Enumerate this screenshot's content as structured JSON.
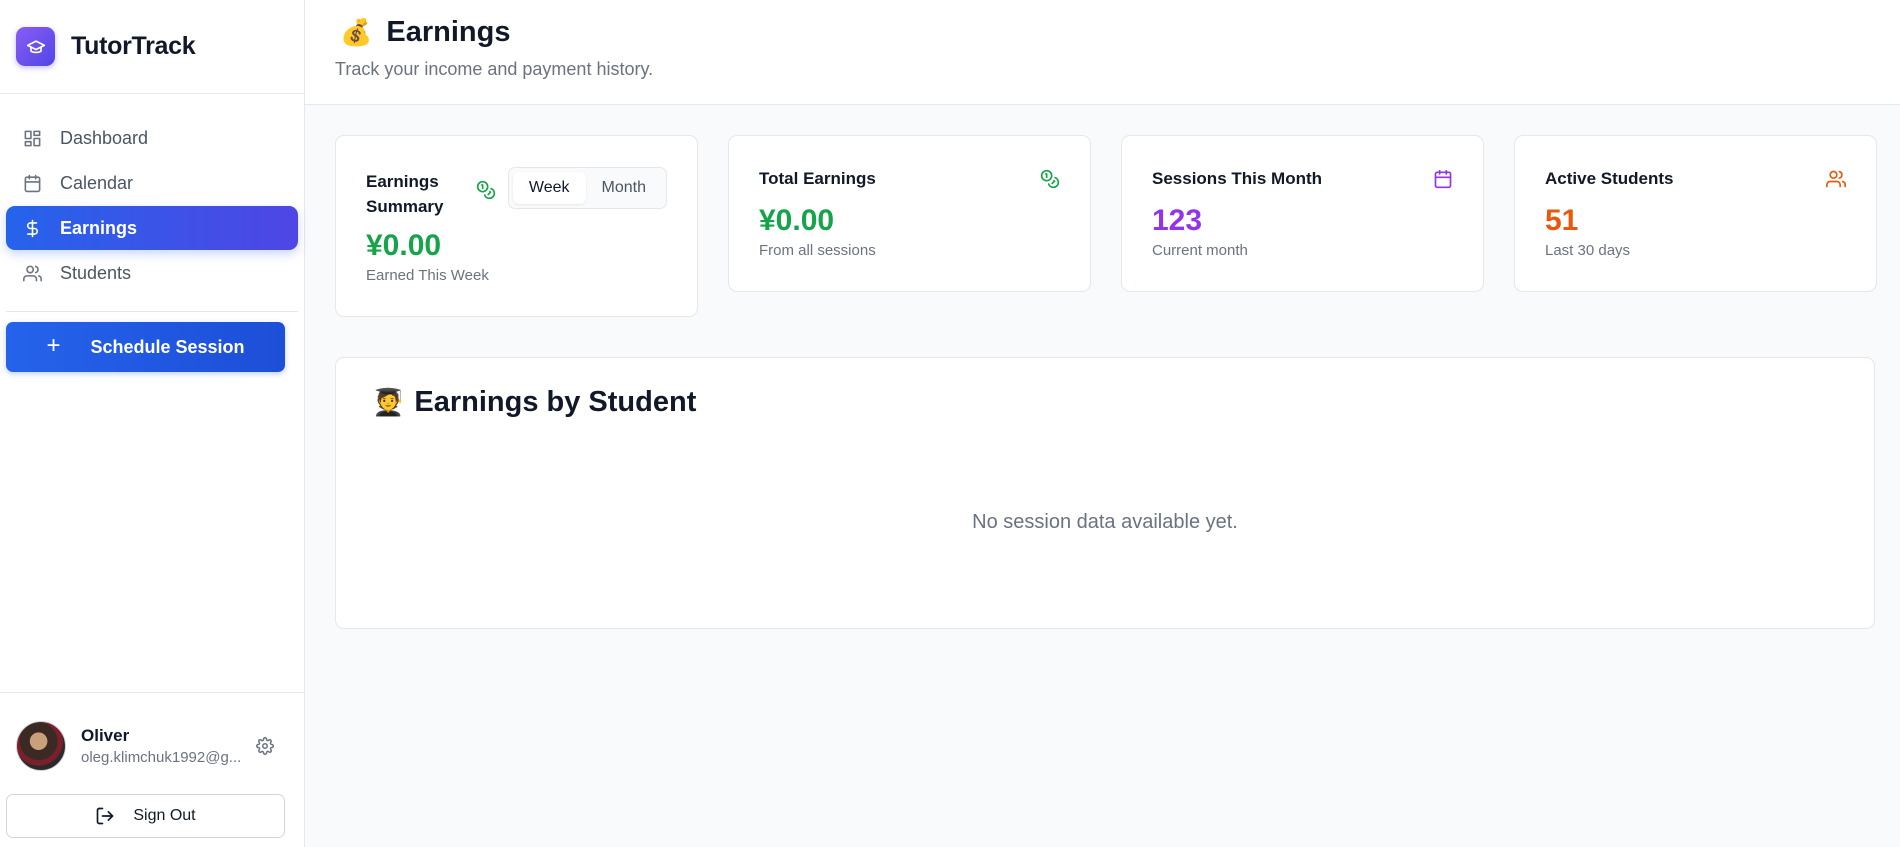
{
  "brand": {
    "name": "TutorTrack"
  },
  "nav": {
    "items": [
      {
        "label": "Dashboard"
      },
      {
        "label": "Calendar"
      },
      {
        "label": "Earnings"
      },
      {
        "label": "Students"
      }
    ],
    "schedule_label": "Schedule Session"
  },
  "user": {
    "name": "Oliver",
    "email": "oleg.klimchuk1992@g...",
    "signout_label": "Sign Out"
  },
  "header": {
    "emoji": "💰",
    "title": "Earnings",
    "subtitle": "Track your income and payment history."
  },
  "summary": {
    "label": "Earnings Summary",
    "toggle": [
      "Week",
      "Month"
    ],
    "selected": "Week",
    "value": "¥0.00",
    "sub": "Earned This Week"
  },
  "cards": [
    {
      "label": "Total Earnings",
      "value": "¥0.00",
      "sub": "From all sessions",
      "color": "#16a34a",
      "icon": "coins-icon"
    },
    {
      "label": "Sessions This Month",
      "value": "123",
      "sub": "Current month",
      "color": "#9333ea",
      "icon": "calendar-icon"
    },
    {
      "label": "Active Students",
      "value": "51",
      "sub": "Last 30 days",
      "color": "#ea580c",
      "icon": "users-icon"
    }
  ],
  "students_panel": {
    "emoji": "🧑‍🎓",
    "title": "Earnings by Student",
    "empty": "No session data available yet."
  },
  "colors": {
    "accent": "#2563eb",
    "green": "#16a34a",
    "purple": "#9333ea",
    "orange": "#ea580c"
  }
}
